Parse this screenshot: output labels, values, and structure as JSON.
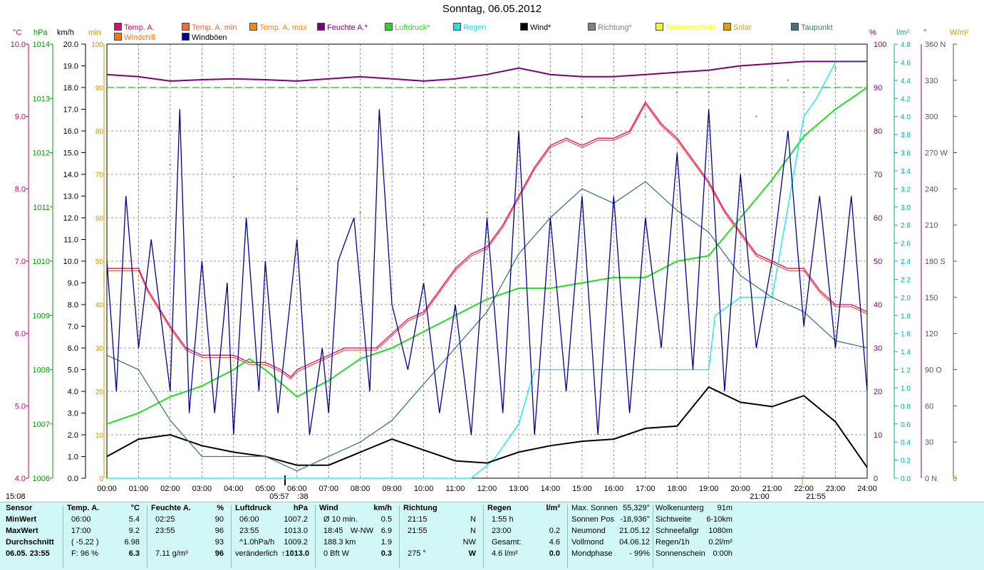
{
  "title": "Sonntag, 06.05.2012",
  "legend": [
    {
      "label": "Temp. A.",
      "color": "#ee0077"
    },
    {
      "label": "Temp. A. min",
      "color": "#ff6633"
    },
    {
      "label": "Temp. A. max",
      "color": "#ff8800"
    },
    {
      "label": "Feuchte A.*",
      "color": "#7a007a"
    },
    {
      "label": "Luftdruck*",
      "color": "#22dd22"
    },
    {
      "label": "Regen",
      "color": "#00eeee"
    },
    {
      "label": "Wind*",
      "color": "#000000"
    },
    {
      "label": "Richtung*",
      "color": "#808080"
    },
    {
      "label": "Sonnenschein",
      "color": "#ffff00"
    },
    {
      "label": "Solar",
      "color": "#e0a000"
    },
    {
      "label": "Taupunkt",
      "color": "#3c7878"
    },
    {
      "label": "Windchill",
      "color": "#ff7700"
    },
    {
      "label": "Windböen",
      "color": "#000099"
    }
  ],
  "units": {
    "temp": "°C",
    "pressure": "hPa",
    "wind": "km/h",
    "minutes": "min",
    "percent": "%",
    "rain": "l/m²",
    "degree": "°",
    "solar": "W/m²"
  },
  "axes": {
    "temp_ticks": [
      "10.0",
      "9.0",
      "8.0",
      "7.0",
      "6.0",
      "5.0",
      "4.0"
    ],
    "pressure_ticks": [
      "1014",
      "1013",
      "1012",
      "1011",
      "1010",
      "1009",
      "1008",
      "1007",
      "1006"
    ],
    "wind_ticks": [
      "20.0",
      "19.0",
      "18.0",
      "17.0",
      "16.0",
      "15.0",
      "14.0",
      "13.0",
      "12.0",
      "11.0",
      "10.0",
      "9.0",
      "8.0",
      "7.0",
      "6.0",
      "5.0",
      "4.0",
      "3.0",
      "2.0",
      "1.0",
      "0.0"
    ],
    "minutes_ticks": [
      "100",
      "90",
      "80",
      "70",
      "60",
      "50",
      "40",
      "30",
      "20",
      "10",
      "0"
    ],
    "humidity_ticks": [
      "100",
      "90",
      "80",
      "70",
      "60",
      "50",
      "40",
      "30",
      "20",
      "10",
      "0"
    ],
    "rain_ticks": [
      "4.8",
      "4.6",
      "4.4",
      "4.2",
      "4.0",
      "3.8",
      "3.6",
      "3.4",
      "3.2",
      "3.0",
      "2.8",
      "2.6",
      "2.4",
      "2.2",
      "2.0",
      "1.8",
      "1.6",
      "1.4",
      "1.2",
      "1.0",
      "0.8",
      "0.6",
      "0.4",
      "0.2",
      "0.0"
    ],
    "direction_ticks": [
      "360 N",
      "330",
      "300",
      "270 W",
      "240",
      "210",
      "180 S",
      "150",
      "120",
      "90 O",
      "60",
      "30",
      "0 N"
    ],
    "solar_ticks": [
      "0"
    ],
    "time_ticks": [
      "00:00",
      "01:00",
      "02:00",
      "03:00",
      "04:00",
      "05:00",
      "06:00",
      "07:00",
      "08:00",
      "09:00",
      "10:00",
      "11:00",
      "12:00",
      "13:00",
      "14:00",
      "15:00",
      "16:00",
      "17:00",
      "18:00",
      "19:00",
      "20:00",
      "21:00",
      "22:00",
      "23:00",
      "24:00"
    ],
    "sun_marks": {
      "sunrise": "05:57",
      "sunrise_min": ":38",
      "time_21": "21:00",
      "sunset": "21:55",
      "left": "15:08"
    }
  },
  "chart_data": {
    "type": "line",
    "x_unit": "hour",
    "series": [
      {
        "name": "Temp. A.",
        "axis": "°C",
        "color": "#ee0077",
        "x": [
          0,
          0.5,
          1,
          1.3,
          2,
          2.5,
          3,
          3.5,
          4,
          4.5,
          5,
          5.5,
          5.8,
          6,
          6.5,
          7,
          7.5,
          8,
          8.5,
          9,
          9.5,
          10,
          10.5,
          11,
          11.5,
          12,
          12.5,
          13,
          13.5,
          14,
          14.5,
          15,
          15.5,
          16,
          16.5,
          17,
          17.5,
          18,
          18.5,
          19,
          19.5,
          20,
          20.5,
          21,
          21.5,
          22,
          22.5,
          23,
          23.5,
          24
        ],
        "y": [
          6.9,
          6.9,
          6.9,
          6.6,
          6.1,
          5.8,
          5.7,
          5.7,
          5.7,
          5.6,
          5.6,
          5.5,
          5.4,
          5.5,
          5.6,
          5.7,
          5.8,
          5.8,
          5.8,
          6.0,
          6.2,
          6.3,
          6.6,
          6.9,
          7.1,
          7.2,
          7.5,
          7.9,
          8.3,
          8.6,
          8.7,
          8.6,
          8.7,
          8.7,
          8.8,
          9.2,
          8.9,
          8.7,
          8.4,
          8.1,
          7.7,
          7.4,
          7.1,
          7.0,
          6.9,
          6.9,
          6.6,
          6.4,
          6.4,
          6.3
        ]
      },
      {
        "name": "Feuchte A.*",
        "axis": "%",
        "color": "#7a007a",
        "x": [
          0,
          1,
          2,
          3,
          4,
          5,
          6,
          7,
          8,
          9,
          10,
          11,
          12,
          13,
          14,
          15,
          16,
          17,
          18,
          19,
          20,
          21,
          22,
          23,
          24
        ],
        "y": [
          93,
          92.5,
          91.5,
          91.8,
          92,
          91.8,
          91.5,
          92,
          92.5,
          92,
          91.5,
          92,
          93,
          94.5,
          93,
          92.5,
          92.5,
          93,
          93.5,
          94,
          95,
          95.5,
          96,
          96,
          96
        ]
      },
      {
        "name": "Luftdruck*",
        "axis": "hPa",
        "color": "#22dd22",
        "x": [
          0,
          1,
          2,
          3,
          4,
          4.5,
          5,
          6,
          7,
          8,
          9,
          10,
          11,
          12,
          13,
          14,
          15,
          16,
          17,
          18,
          19,
          20,
          21,
          22,
          23,
          24
        ],
        "y": [
          1007.0,
          1007.2,
          1007.5,
          1007.7,
          1008.0,
          1008.2,
          1008.0,
          1007.5,
          1007.8,
          1008.2,
          1008.4,
          1008.7,
          1009.0,
          1009.3,
          1009.5,
          1009.5,
          1009.6,
          1009.7,
          1009.7,
          1010.0,
          1010.1,
          1010.8,
          1011.5,
          1012.3,
          1012.8,
          1013.2
        ]
      },
      {
        "name": "Regen",
        "axis": "l/m²",
        "color": "#00eeee",
        "x": [
          0,
          11.5,
          12.2,
          13,
          13.5,
          14,
          18,
          19,
          19.2,
          20,
          21,
          21.3,
          21.8,
          22,
          22.4,
          23,
          23.5,
          24
        ],
        "y": [
          0,
          0,
          0.2,
          0.6,
          1.2,
          1.2,
          1.2,
          1.2,
          1.8,
          2.0,
          2.0,
          2.6,
          3.6,
          4.0,
          4.2,
          4.6,
          4.6,
          4.6
        ]
      },
      {
        "name": "Wind*",
        "axis": "km/h",
        "color": "#000000",
        "x": [
          0,
          1,
          2,
          3,
          4,
          5,
          6,
          7,
          8,
          9,
          10,
          11,
          12,
          13,
          14,
          15,
          16,
          17,
          18,
          19,
          20,
          21,
          22,
          23,
          24
        ],
        "y": [
          1.0,
          1.8,
          2.0,
          1.5,
          1.2,
          1.0,
          0.6,
          0.6,
          1.2,
          1.8,
          1.3,
          0.8,
          0.7,
          1.2,
          1.5,
          1.7,
          1.8,
          2.3,
          2.4,
          4.2,
          3.5,
          3.3,
          3.8,
          2.6,
          0.5
        ]
      },
      {
        "name": "Taupunkt",
        "axis": "°C",
        "color": "#3c7878",
        "x": [
          0,
          1,
          2,
          3,
          4,
          5,
          6,
          7,
          8,
          9,
          10,
          11,
          12,
          13,
          14,
          15,
          16,
          17,
          18,
          19,
          20,
          21,
          22,
          23,
          24
        ],
        "y": [
          5.7,
          5.5,
          4.8,
          4.3,
          4.3,
          4.3,
          4.1,
          4.3,
          4.5,
          4.8,
          5.3,
          5.8,
          6.3,
          7.1,
          7.6,
          8.0,
          7.8,
          8.1,
          7.7,
          7.4,
          6.8,
          6.5,
          6.3,
          5.9,
          5.8
        ]
      },
      {
        "name": "Windböen",
        "axis": "km/h",
        "color": "#000099",
        "x": [
          0,
          0.3,
          0.6,
          1,
          1.4,
          2,
          2.3,
          2.6,
          3,
          3.4,
          3.8,
          4,
          4.4,
          4.8,
          5,
          5.4,
          6,
          6.4,
          6.8,
          7,
          7.3,
          7.8,
          8.3,
          8.6,
          9,
          9.5,
          10,
          10.5,
          11,
          11.5,
          12,
          12.5,
          13,
          13.5,
          14,
          14.5,
          15,
          15.5,
          16,
          16.5,
          17,
          17.5,
          18,
          18.5,
          19,
          19.5,
          20,
          20.5,
          21,
          21.5,
          22,
          22.5,
          23,
          23.5,
          24
        ],
        "y": [
          10,
          4,
          13,
          6,
          11,
          4,
          17,
          3,
          10,
          3,
          9,
          2,
          12,
          4,
          10,
          3,
          11,
          2,
          6,
          3,
          10,
          12,
          4,
          17,
          8,
          5,
          9,
          3,
          8,
          2,
          12,
          3,
          16,
          2,
          12,
          4,
          13,
          2,
          13,
          3,
          12,
          6,
          15,
          5,
          17,
          4,
          14,
          6,
          10,
          16,
          7,
          13,
          6,
          13,
          4
        ]
      },
      {
        "name": "Richtung*",
        "axis": "°",
        "color": "#808080",
        "x": [
          0,
          2,
          4,
          6,
          8,
          10,
          12,
          14,
          15,
          16,
          17,
          18,
          19,
          20,
          20.5,
          21,
          21.5,
          22,
          23,
          24
        ],
        "y": [
          200,
          260,
          250,
          240,
          220,
          210,
          220,
          270,
          300,
          330,
          300,
          320,
          320,
          340,
          300,
          330,
          330,
          320,
          340,
          330
        ]
      }
    ],
    "xlim": [
      0,
      24
    ],
    "ylim_temp": [
      4.0,
      10.0
    ],
    "ylim_pressure": [
      1006,
      1014
    ],
    "ylim_wind": [
      0,
      20
    ],
    "ylim_percent": [
      0,
      100
    ],
    "ylim_rain": [
      0,
      4.8
    ],
    "ylim_direction": [
      0,
      360
    ],
    "grid": true
  },
  "panel": {
    "sensor": {
      "header": "Sensor",
      "rows": [
        "MinWert",
        "MaxWert",
        "Durchschnitt",
        "06.05. 23:55"
      ]
    },
    "temp": {
      "header": "Temp. A.",
      "unit": "°C",
      "rows": [
        [
          "06:00",
          "5.4"
        ],
        [
          "17:00",
          "9.2"
        ],
        [
          "( -5.22 )",
          "6.98"
        ],
        [
          "F: 96 %",
          "6.3"
        ]
      ]
    },
    "humidity": {
      "header": "Feuchte A.",
      "unit": "%",
      "rows": [
        [
          "02:25",
          "90"
        ],
        [
          "23:55",
          "96"
        ],
        [
          "",
          "93"
        ],
        [
          "7.11 g/m³",
          "96"
        ]
      ]
    },
    "pressure": {
      "header": "Luftdruck",
      "unit": "hPa",
      "rows": [
        [
          "06:00",
          "1007.2"
        ],
        [
          "23:55",
          "1013.0"
        ],
        [
          "^1.0hPa/h",
          "1009.2"
        ],
        [
          "veränderlich",
          "1013.0"
        ]
      ],
      "arrow": "↑"
    },
    "wind": {
      "header": "Wind",
      "unit": "km/h",
      "rows": [
        [
          "Ø 10 min.",
          "",
          "0.5"
        ],
        [
          "18:45",
          "W-NW",
          "6.9"
        ],
        [
          "188.3 km",
          "",
          "1.9"
        ],
        [
          "0 Bft W",
          "",
          "0.3"
        ]
      ]
    },
    "direction": {
      "header": "Richtung",
      "rows": [
        [
          "21:15",
          "N"
        ],
        [
          "21:55",
          "N"
        ],
        [
          "",
          "NW"
        ],
        [
          "275 °",
          "W"
        ]
      ]
    },
    "rain": {
      "header": "Regen",
      "unit": "l/m²",
      "rows": [
        [
          "1:55 h",
          ""
        ],
        [
          "23:00",
          "0.2"
        ],
        [
          "Gesamt:",
          "4.6"
        ],
        [
          "4.6 l/m²",
          "0.0"
        ]
      ]
    },
    "sun": {
      "rows": [
        [
          "Max. Sonnen",
          "55,329°"
        ],
        [
          "Sonnen Pos",
          "-18,936°"
        ],
        [
          "Neumond",
          "21.05.12"
        ],
        [
          "Vollmond",
          "04.06.12"
        ],
        [
          "Mondphase",
          "- 99%"
        ]
      ]
    },
    "misc": {
      "rows": [
        [
          "Wolkenunterg",
          "91m"
        ],
        [
          "Sichtweite",
          "6-10km"
        ],
        [
          "Schneefallgr",
          "1080m"
        ],
        [
          "Regen/1h",
          "0.2l/m²"
        ],
        [
          "Sonnenschein",
          "0:00h"
        ]
      ]
    }
  }
}
